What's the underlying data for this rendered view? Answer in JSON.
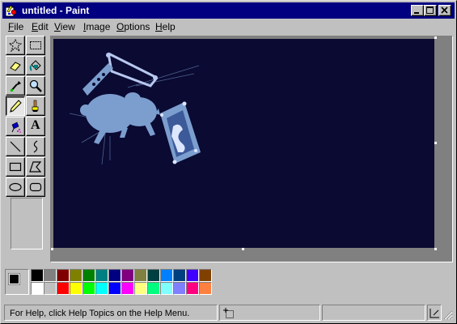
{
  "window": {
    "title": "untitled - Paint"
  },
  "menubar": {
    "items": [
      {
        "label": "File",
        "key": "F"
      },
      {
        "label": "Edit",
        "key": "E"
      },
      {
        "label": "View",
        "key": "V"
      },
      {
        "label": "Image",
        "key": "I"
      },
      {
        "label": "Options",
        "key": "O"
      },
      {
        "label": "Help",
        "key": "H"
      }
    ]
  },
  "tools": [
    {
      "name": "free-form-select-icon"
    },
    {
      "name": "select-icon"
    },
    {
      "name": "eraser-icon"
    },
    {
      "name": "fill-with-color-icon"
    },
    {
      "name": "pick-color-icon"
    },
    {
      "name": "magnifier-icon"
    },
    {
      "name": "pencil-icon",
      "selected": true
    },
    {
      "name": "brush-icon"
    },
    {
      "name": "airbrush-icon"
    },
    {
      "name": "text-icon",
      "glyph": "A"
    },
    {
      "name": "line-icon"
    },
    {
      "name": "curve-icon"
    },
    {
      "name": "rectangle-icon"
    },
    {
      "name": "polygon-icon"
    },
    {
      "name": "ellipse-icon"
    },
    {
      "name": "rounded-rectangle-icon"
    }
  ],
  "canvas": {
    "background": "#0a0a32",
    "art_color": "#7c9ecf"
  },
  "palette": {
    "foreground": "#000000",
    "background": "#ffffff",
    "row1": [
      "#000000",
      "#808080",
      "#800000",
      "#808000",
      "#008000",
      "#008080",
      "#000080",
      "#800080",
      "#808040",
      "#004040",
      "#0080ff",
      "#004080",
      "#4000ff",
      "#804000"
    ],
    "row2": [
      "#ffffff",
      "#c0c0c0",
      "#ff0000",
      "#ffff00",
      "#00ff00",
      "#00ffff",
      "#0000ff",
      "#ff00ff",
      "#ffff80",
      "#00ff80",
      "#80ffff",
      "#8080ff",
      "#ff0080",
      "#ff8040"
    ]
  },
  "statusbar": {
    "help_text": "For Help, click Help Topics on the Help Menu."
  }
}
